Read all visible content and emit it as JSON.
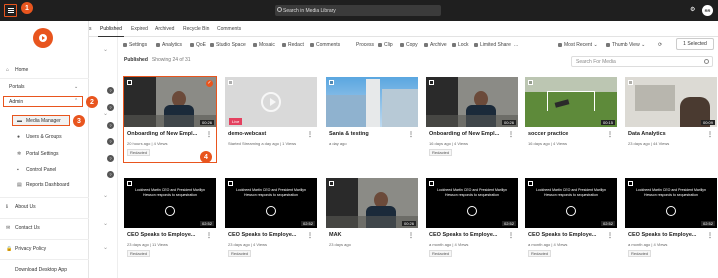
{
  "topbar": {
    "search_placeholder": "Search in Media Library",
    "avatar_initials": "RR",
    "brand_color": "#e8551e"
  },
  "callouts": [
    "1",
    "2",
    "3",
    "4"
  ],
  "sidebar": {
    "items": [
      {
        "label": "Home",
        "icon": "home-icon"
      },
      {
        "label": "Portals",
        "icon": ""
      },
      {
        "label": "Admin",
        "icon": ""
      },
      {
        "label": "Media Manager",
        "icon": "folder-icon"
      },
      {
        "label": "Users & Groups",
        "icon": "users-icon"
      },
      {
        "label": "Portal Settings",
        "icon": "gear-icon"
      },
      {
        "label": "Control Panel",
        "icon": "panel-icon"
      },
      {
        "label": "Reports Dashboard",
        "icon": "report-icon"
      },
      {
        "label": "About Us",
        "icon": "info-icon"
      },
      {
        "label": "Contact Us",
        "icon": "mail-icon"
      },
      {
        "label": "Privacy Policy",
        "icon": "lock-icon"
      },
      {
        "label": "Download Desktop App",
        "icon": ""
      }
    ]
  },
  "tabs": [
    "s",
    "Published",
    "Expired",
    "Archived",
    "Recycle Bin",
    "Comments"
  ],
  "toolbar": {
    "items": [
      "Settings",
      "Analytics",
      "QoE",
      "Studio Space",
      "Mosaic",
      "Redact",
      "Comments",
      "Process",
      "Clip",
      "Copy",
      "Archive",
      "Lock",
      "Limited Share",
      "..."
    ],
    "sort": "Most Recent",
    "view": "Thumb View",
    "selected": "1 Selected"
  },
  "section": {
    "title": "Published",
    "count": "Showing 24 of 31",
    "search_placeholder": "Search For Media"
  },
  "cards": [
    {
      "title": "Onboarding of New Empl...",
      "meta": "20 hours ago | 4 Views",
      "badge": "Redacted",
      "duration": "00:26",
      "thumb": "office",
      "selected": true
    },
    {
      "title": "demo-webcast",
      "meta": "Started Streaming a day ago | 1 Views",
      "badge": "",
      "duration": "",
      "thumb": "webcast",
      "live": "Live"
    },
    {
      "title": "Sania & testing",
      "meta": "a day ago",
      "badge": "",
      "duration": "",
      "thumb": "sky"
    },
    {
      "title": "Onboarding of New Empl...",
      "meta": "16 days ago | 4 Views",
      "badge": "Redacted",
      "duration": "00:26",
      "thumb": "office"
    },
    {
      "title": "soccer practice",
      "meta": "16 days ago | 4 Views",
      "badge": "",
      "duration": "00:15",
      "thumb": "soccer"
    },
    {
      "title": "Data Analytics",
      "meta": "23 days ago | 44 Views",
      "badge": "",
      "duration": "00:09",
      "thumb": "analytics"
    },
    {
      "title": "CEO Speaks to Employe...",
      "meta": "23 days ago | 11 Views",
      "badge": "Redacted",
      "duration": "02:52",
      "thumb": "slide"
    },
    {
      "title": "CEO Speaks to Employe...",
      "meta": "23 days ago | 4 Views",
      "badge": "Redacted",
      "duration": "02:52",
      "thumb": "slide"
    },
    {
      "title": "MAK",
      "meta": "23 days ago",
      "badge": "",
      "duration": "00:26",
      "thumb": "office"
    },
    {
      "title": "CEO Speaks to Employe...",
      "meta": "a month ago | 4 Views",
      "badge": "Redacted",
      "duration": "02:52",
      "thumb": "slide"
    },
    {
      "title": "CEO Speaks to Employe...",
      "meta": "a month ago | 4 Views",
      "badge": "Redacted",
      "duration": "02:52",
      "thumb": "slide"
    },
    {
      "title": "CEO Speaks to Employe...",
      "meta": "a month ago | 4 Views",
      "badge": "Redacted",
      "duration": "02:52",
      "thumb": "slide"
    }
  ],
  "slide_text": "Lockheed Martin CEO and President Marillyn Hewson responds to sequestration"
}
